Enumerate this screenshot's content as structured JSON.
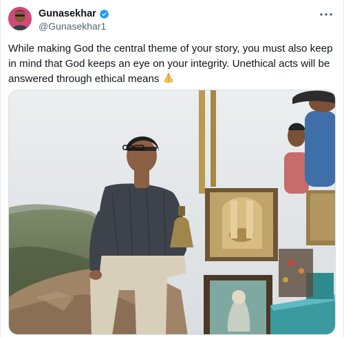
{
  "author": {
    "display_name": "Gunasekhar",
    "handle": "@Gunasekhar1",
    "verified": true,
    "avatar_icon": "avatar-photo"
  },
  "tweet": {
    "text": "While making God the central theme of your story, you must also keep in mind that God keeps an eye on your integrity. Unethical acts will be answered through ethical means",
    "emoji": "folded-hands-emoji"
  },
  "media": {
    "type": "photo",
    "icon": "photo-image"
  },
  "menu": {
    "icon": "more-options-icon"
  },
  "colors": {
    "verified_badge": "#1d9bf0",
    "handle_text": "#536471",
    "text": "#0f1419"
  }
}
